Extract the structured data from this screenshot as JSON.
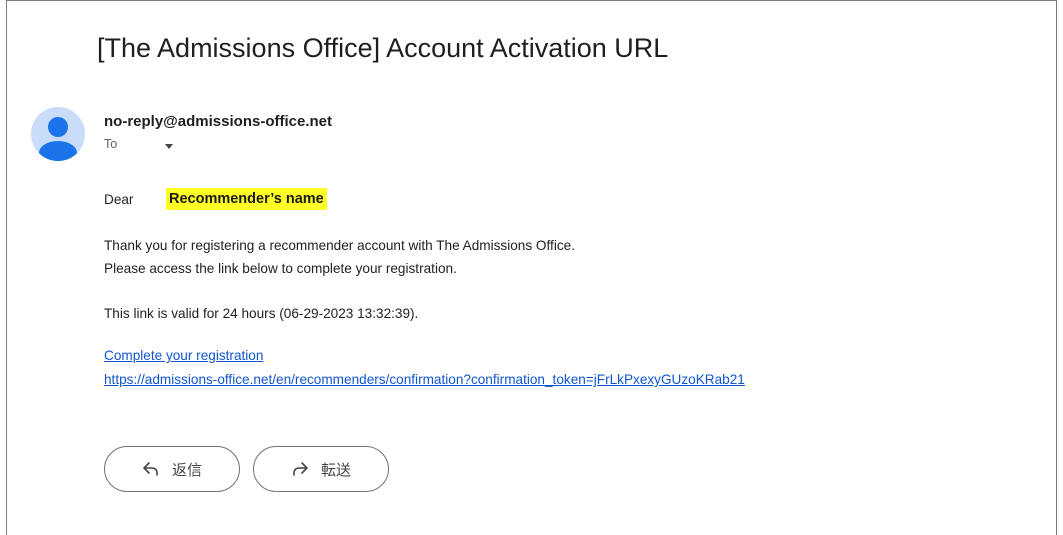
{
  "email": {
    "subject": "[The Admissions Office] Account Activation URL",
    "sender": "no-reply@admissions-office.net",
    "recipient_label": "To",
    "greeting": "Dear",
    "recipient_name": "Recommender’s name",
    "body_line_1": "Thank you for registering a recommender account with The Admissions Office.",
    "body_line_2": "Please access the link below to complete your registration.",
    "validity_line": "This link is valid for 24 hours (06-29-2023 13:32:39).",
    "link_label": "Complete your registration",
    "link_url": "https://admissions-office.net/en/recommenders/confirmation?confirmation_token=jFrLkPxexyGUzoKRab21"
  },
  "actions": {
    "reply_label": "返信",
    "forward_label": "転送"
  },
  "icons": {
    "avatar": "person-icon",
    "recipient_dropdown": "caret-down-icon",
    "reply": "reply-arrow-icon",
    "forward": "forward-arrow-icon"
  },
  "colors": {
    "link": "#1155cc",
    "highlight": "#ffff26",
    "avatar_bg": "#c9dcf9",
    "avatar_fg": "#1a73e8"
  }
}
